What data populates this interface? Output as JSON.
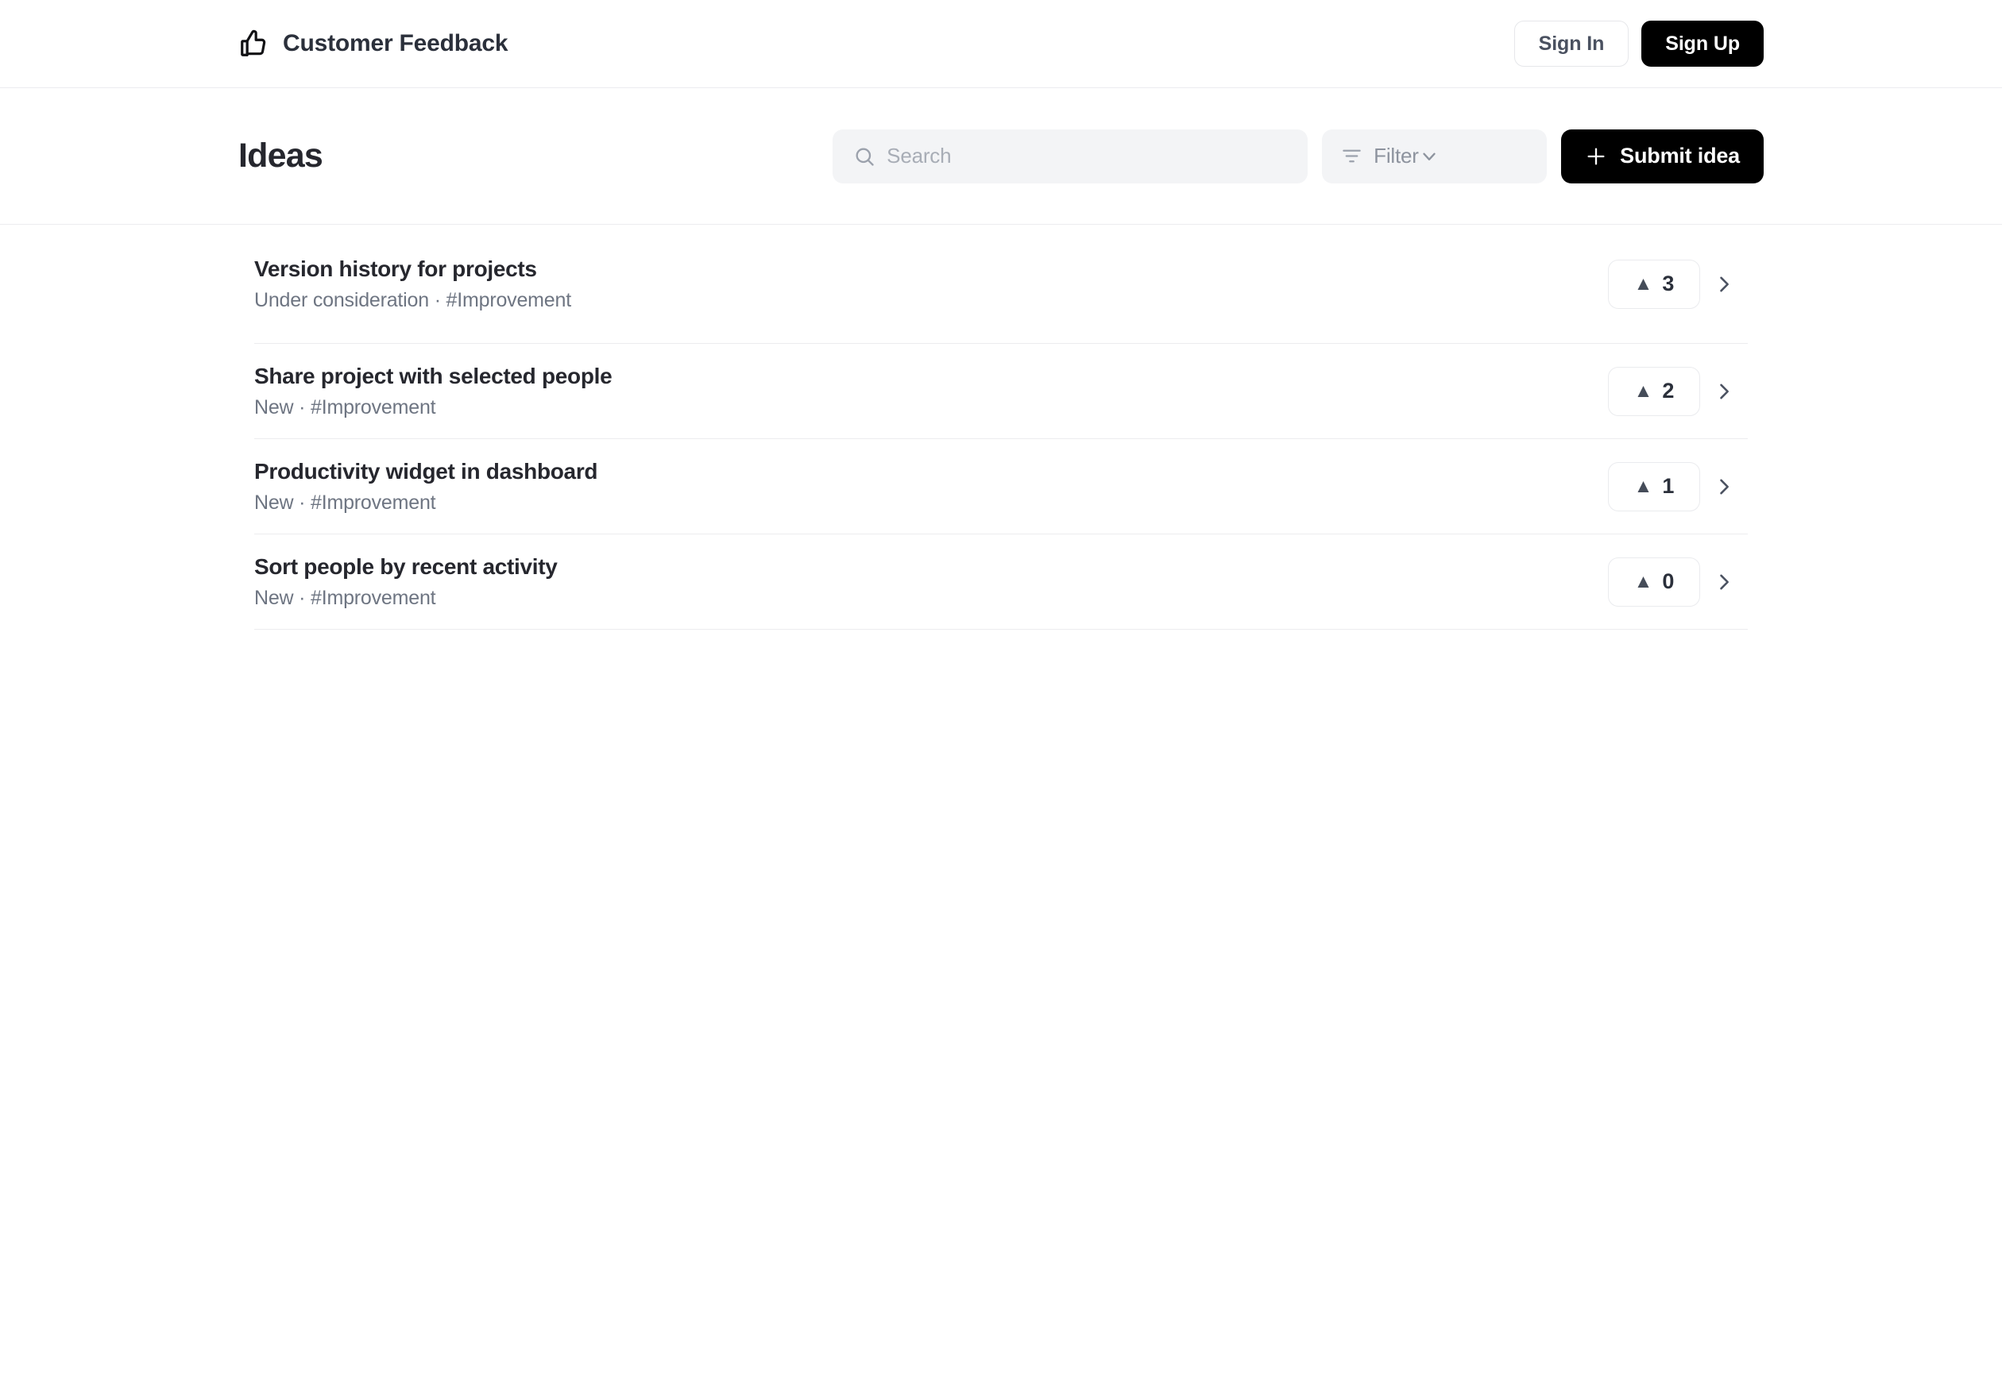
{
  "header": {
    "brand_icon": "thumbs-up-icon",
    "brand_name": "Customer Feedback",
    "sign_in_label": "Sign In",
    "sign_up_label": "Sign Up"
  },
  "toolbar": {
    "page_title": "Ideas",
    "search_icon": "search-icon",
    "search_placeholder": "Search",
    "search_value": "",
    "filter_icon": "filter-icon",
    "filter_label": "Filter",
    "filter_chevron_icon": "chevron-down-icon",
    "submit_plus_icon": "plus-icon",
    "submit_label": "Submit idea"
  },
  "ideas": [
    {
      "title": "Version history for projects",
      "meta": "Under consideration · #Improvement",
      "status": "Under consideration",
      "tag": "#Improvement",
      "votes": "3",
      "vote_arrow": "▲",
      "chevron_icon": "chevron-right-icon"
    },
    {
      "title": "Share project with selected people",
      "meta": "New · #Improvement",
      "status": "New",
      "tag": "#Improvement",
      "votes": "2",
      "vote_arrow": "▲",
      "chevron_icon": "chevron-right-icon"
    },
    {
      "title": "Productivity widget in dashboard",
      "meta": "New · #Improvement",
      "status": "New",
      "tag": "#Improvement",
      "votes": "1",
      "vote_arrow": "▲",
      "chevron_icon": "chevron-right-icon"
    },
    {
      "title": "Sort people by recent activity",
      "meta": "New · #Improvement",
      "status": "New",
      "tag": "#Improvement",
      "votes": "0",
      "vote_arrow": "▲",
      "chevron_icon": "chevron-right-icon"
    }
  ],
  "colors": {
    "accent": "#000000",
    "text_primary": "#26272e",
    "text_muted": "#6e7582",
    "field_bg": "#f3f4f6",
    "border": "#ececef"
  }
}
